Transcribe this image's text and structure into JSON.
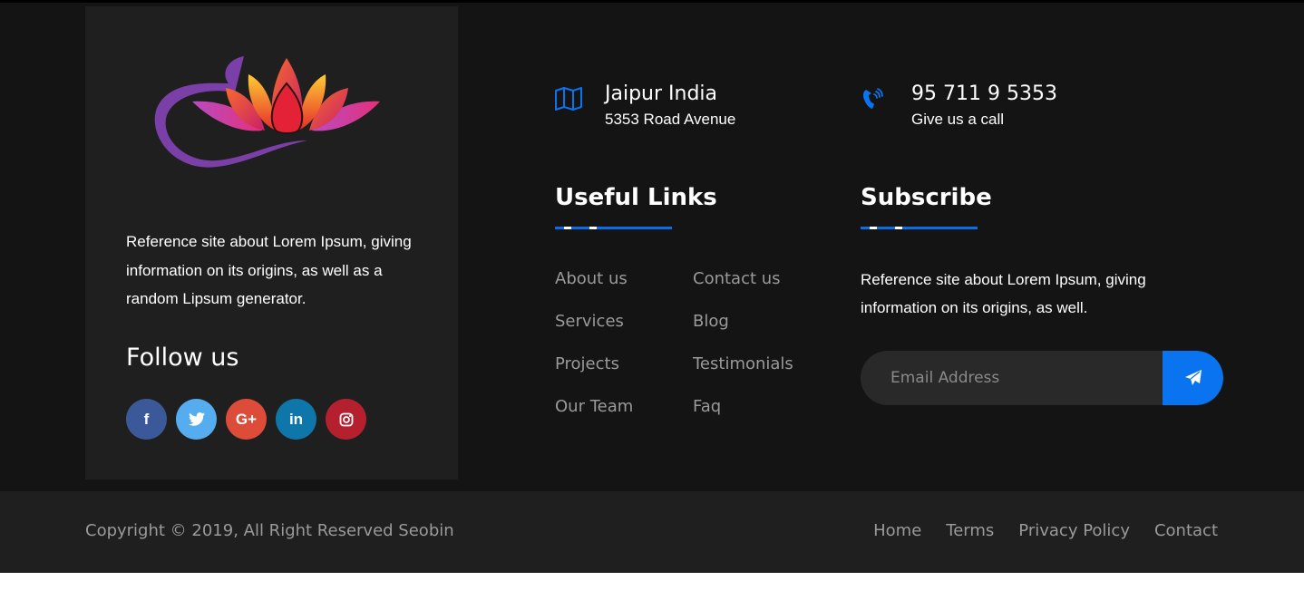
{
  "about": {
    "text": "Reference site about Lorem Ipsum, giving information on its origins, as well as a random Lipsum generator.",
    "follow_title": "Follow us",
    "social": [
      {
        "icon": "facebook-icon",
        "glyph": "f",
        "color": "#3b5998"
      },
      {
        "icon": "twitter-icon",
        "glyph": "t",
        "color": "#55acee"
      },
      {
        "icon": "google-plus-icon",
        "glyph": "G+",
        "color": "#dd4b39"
      },
      {
        "icon": "linkedin-icon",
        "glyph": "in",
        "color": "#0e76a8"
      },
      {
        "icon": "instagram-icon",
        "glyph": "ig",
        "color": "#b5202e"
      }
    ]
  },
  "contact": {
    "address_title": "Jaipur India",
    "address_sub": "5353 Road Avenue",
    "phone_title": "95 711 9 5353",
    "phone_sub": "Give us a call",
    "icon_color": "#0a74f0"
  },
  "useful_links": {
    "title": "Useful Links",
    "items": [
      "About us",
      "Contact us",
      "Services",
      "Blog",
      "Projects",
      "Testimonials",
      "Our Team",
      "Faq"
    ]
  },
  "subscribe": {
    "title": "Subscribe",
    "text": "Reference site about Lorem Ipsum, giving information on its origins, as well.",
    "placeholder": "Email Address"
  },
  "bottom": {
    "copyright": "Copyright © 2019, All Right Reserved Seobin",
    "nav": [
      "Home",
      "Terms",
      "Privacy Policy",
      "Contact"
    ]
  }
}
